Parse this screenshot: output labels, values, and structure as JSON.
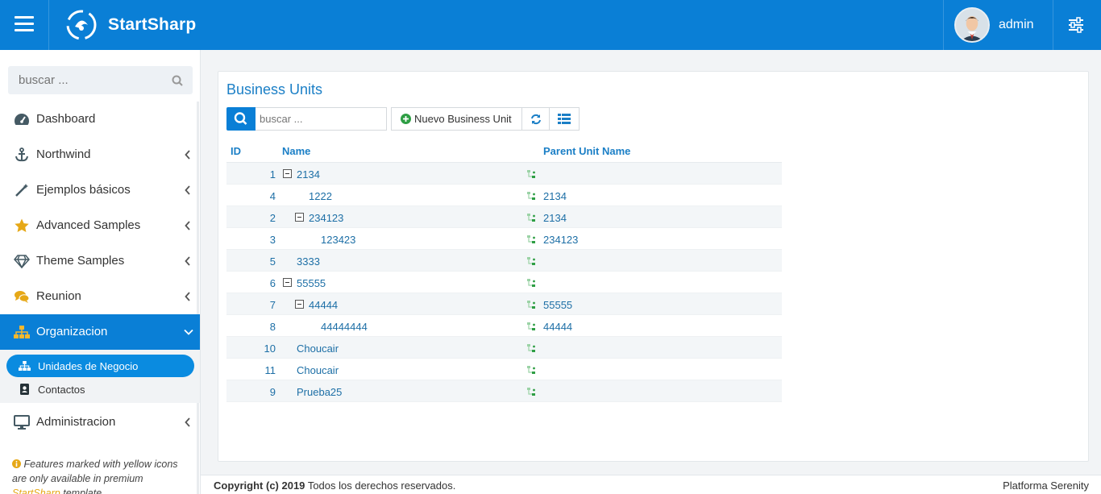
{
  "header": {
    "brand": "StartSharp",
    "username": "admin",
    "accent_color": "#0a7fd6"
  },
  "sidebar": {
    "search_placeholder": "buscar ...",
    "items": [
      {
        "label": "Dashboard",
        "icon": "dashboard-icon",
        "expandable": false
      },
      {
        "label": "Northwind",
        "icon": "anchor-icon",
        "expandable": true
      },
      {
        "label": "Ejemplos básicos",
        "icon": "magic-wand-icon",
        "expandable": true
      },
      {
        "label": "Advanced Samples",
        "icon": "star-icon",
        "expandable": true
      },
      {
        "label": "Theme Samples",
        "icon": "diamond-icon",
        "expandable": true
      },
      {
        "label": "Reunion",
        "icon": "comments-icon",
        "expandable": true
      },
      {
        "label": "Organizacion",
        "icon": "sitemap-icon",
        "expandable": true,
        "expanded": true
      },
      {
        "label": "Administracion",
        "icon": "desktop-icon",
        "expandable": true
      }
    ],
    "subitems": [
      {
        "label": "Unidades de Negocio",
        "icon": "sitemap-icon",
        "active": true
      },
      {
        "label": "Contactos",
        "icon": "address-book-icon",
        "active": false
      }
    ],
    "note": {
      "prefix": "Features marked with yellow icons are only available in premium ",
      "accent": "StartSharp",
      "suffix": " template"
    }
  },
  "main": {
    "title": "Business Units",
    "search_placeholder": "buscar ...",
    "toolbar": {
      "new_label": "Nuevo Business Unit",
      "refresh_icon": "refresh-icon",
      "columns_icon": "column-list-icon"
    },
    "columns": {
      "id": "ID",
      "name": "Name",
      "parent": "Parent Unit Name"
    },
    "rows": [
      {
        "id": "1",
        "name": "2134",
        "parent": "",
        "level": 0,
        "toggle": true
      },
      {
        "id": "4",
        "name": "1222",
        "parent": "2134",
        "level": 1,
        "toggle": false
      },
      {
        "id": "2",
        "name": "234123",
        "parent": "2134",
        "level": 1,
        "toggle": true
      },
      {
        "id": "3",
        "name": "123423",
        "parent": "234123",
        "level": 2,
        "toggle": false
      },
      {
        "id": "5",
        "name": "3333",
        "parent": "",
        "level": 0,
        "toggle": false
      },
      {
        "id": "6",
        "name": "55555",
        "parent": "",
        "level": 0,
        "toggle": true
      },
      {
        "id": "7",
        "name": "44444",
        "parent": "55555",
        "level": 1,
        "toggle": true
      },
      {
        "id": "8",
        "name": "44444444",
        "parent": "44444",
        "level": 2,
        "toggle": false
      },
      {
        "id": "10",
        "name": "Choucair",
        "parent": "",
        "level": 0,
        "toggle": false
      },
      {
        "id": "11",
        "name": "Choucair",
        "parent": "",
        "level": 0,
        "toggle": false
      },
      {
        "id": "9",
        "name": "Prueba25",
        "parent": "",
        "level": 0,
        "toggle": false
      }
    ]
  },
  "footer": {
    "copyright": "Copyright (c) 2019",
    "rights": "Todos los derechos reservados.",
    "platform": "Platforma Serenity"
  }
}
